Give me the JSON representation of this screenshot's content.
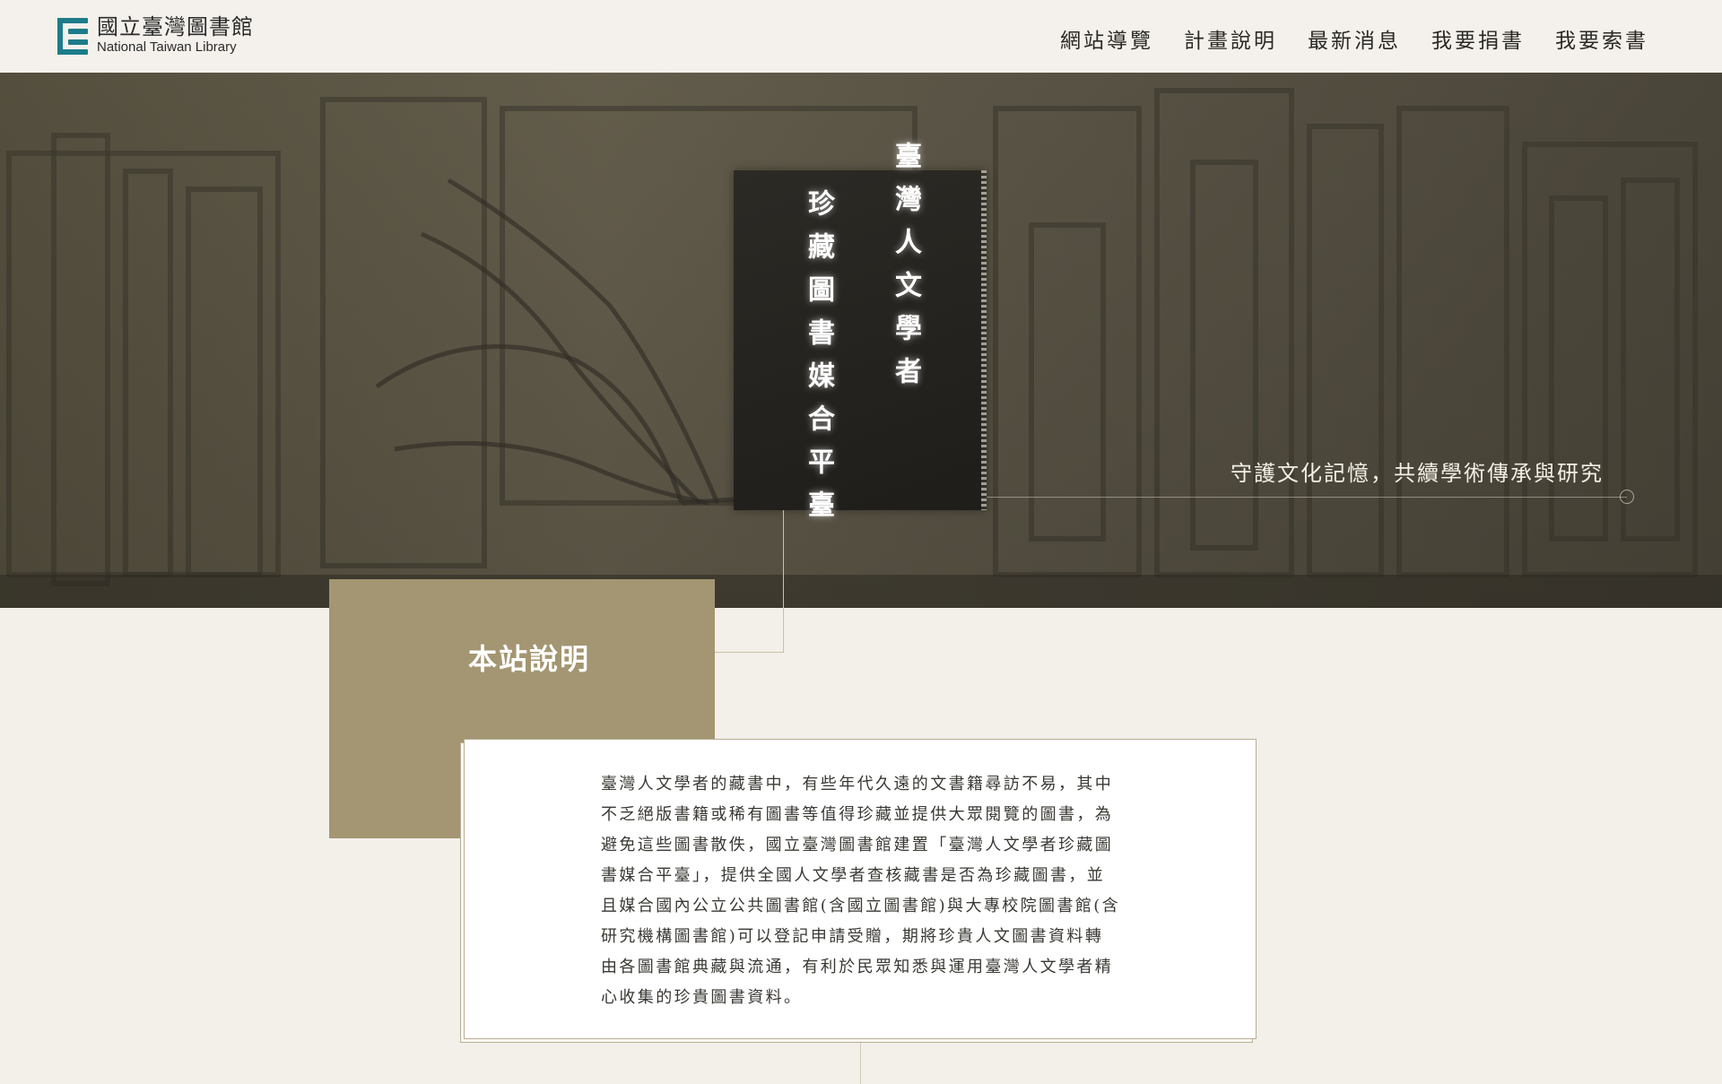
{
  "header": {
    "logo_zh": "國立臺灣圖書館",
    "logo_en": "National Taiwan Library",
    "nav": [
      "網站導覽",
      "計畫說明",
      "最新消息",
      "我要捐書",
      "我要索書"
    ]
  },
  "hero": {
    "title_line1": "臺灣人文學者",
    "title_line2": "珍藏圖書媒合平臺",
    "slogan": "守護文化記憶，共續學術傳承與研究"
  },
  "about": {
    "heading": "本站說明",
    "paragraph": "臺灣人文學者的藏書中，有些年代久遠的文書籍尋訪不易，其中不乏絕版書籍或稀有圖書等值得珍藏並提供大眾閱覽的圖書，為避免這些圖書散佚，國立臺灣圖書館建置「臺灣人文學者珍藏圖書媒合平臺」，提供全國人文學者查核藏書是否為珍藏圖書，並且媒合國內公立公共圖書館(含國立圖書館)與大專校院圖書館(含研究機構圖書館)可以登記申請受贈，期將珍貴人文圖書資料轉由各圖書館典藏與流通，有利於民眾知悉與運用臺灣人文學者精心收集的珍貴圖書資料。"
  },
  "colors": {
    "accent": "#a49672",
    "logo": "#1d7c8a",
    "background": "#f3f0ea"
  }
}
